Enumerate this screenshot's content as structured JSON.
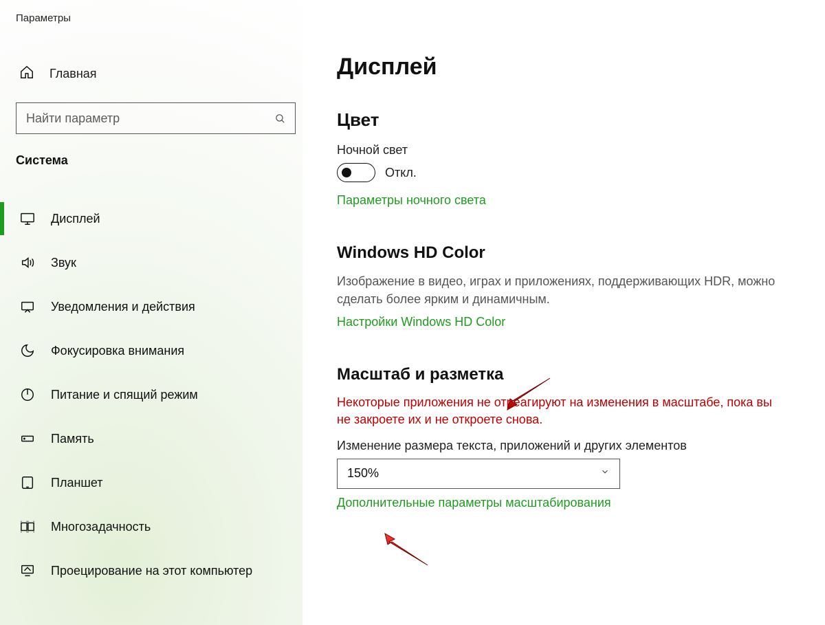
{
  "window": {
    "title": "Параметры"
  },
  "sidebar": {
    "home_label": "Главная",
    "search_placeholder": "Найти параметр",
    "category_label": "Система",
    "items": [
      {
        "id": "display",
        "label": "Дисплей",
        "active": true
      },
      {
        "id": "sound",
        "label": "Звук"
      },
      {
        "id": "notifications",
        "label": "Уведомления и действия"
      },
      {
        "id": "focus",
        "label": "Фокусировка внимания"
      },
      {
        "id": "power",
        "label": "Питание и спящий режим"
      },
      {
        "id": "storage",
        "label": "Память"
      },
      {
        "id": "tablet",
        "label": "Планшет"
      },
      {
        "id": "multitask",
        "label": "Многозадачность"
      },
      {
        "id": "projecting",
        "label": "Проецирование на этот компьютер"
      }
    ]
  },
  "main": {
    "page_title": "Дисплей",
    "color_section": {
      "heading": "Цвет",
      "night_light_label": "Ночной свет",
      "toggle_state_label": "Откл.",
      "night_light_settings_link": "Параметры ночного света"
    },
    "hd_color_section": {
      "heading": "Windows HD Color",
      "description": "Изображение в видео, играх и приложениях, поддерживающих HDR, можно сделать более ярким и динамичным.",
      "settings_link": "Настройки Windows HD Color"
    },
    "scale_section": {
      "heading": "Масштаб и разметка",
      "warning": "Некоторые приложения не отреагируют на изменения в масштабе, пока вы не закроете их и не откроете снова.",
      "resize_label": "Изменение размера текста, приложений и других элементов",
      "selected_scale": "150%",
      "advanced_link": "Дополнительные параметры масштабирования"
    }
  }
}
